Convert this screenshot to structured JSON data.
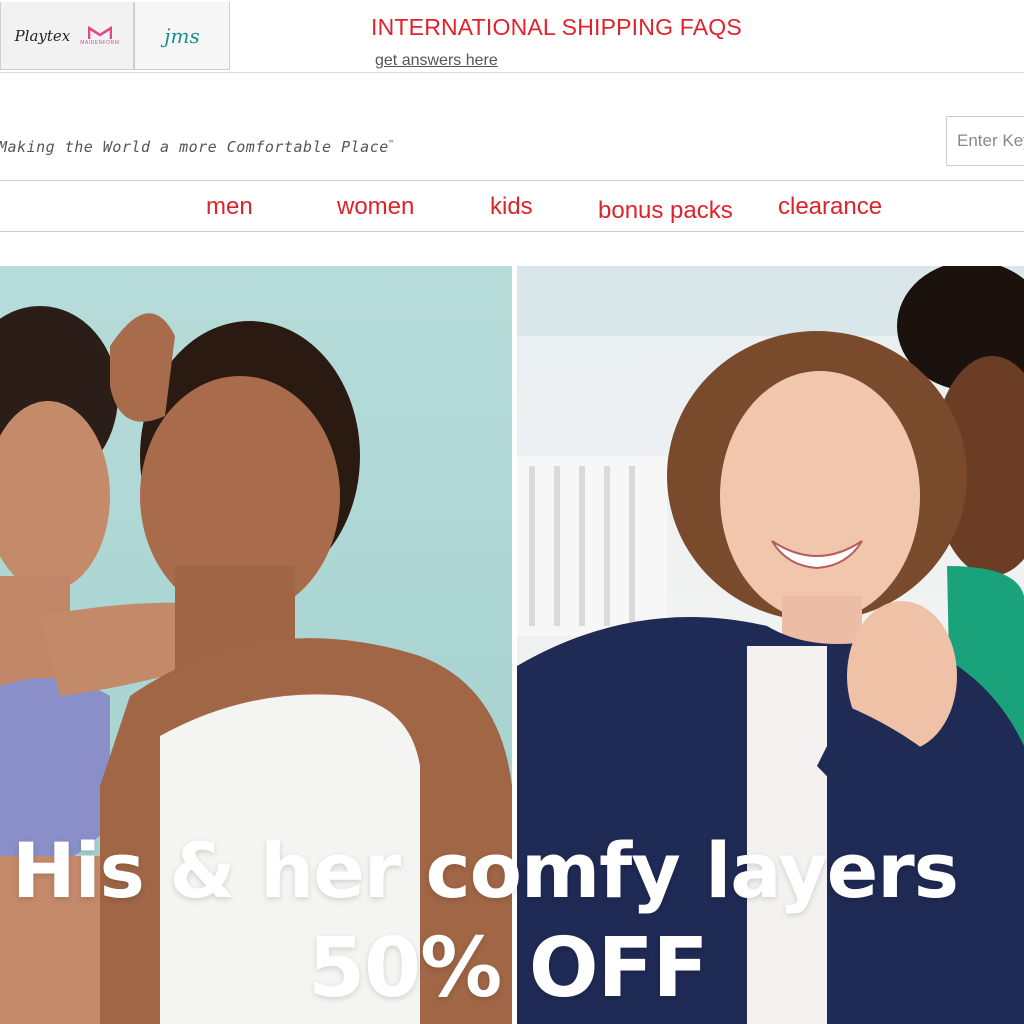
{
  "brand_tabs": {
    "playtex": "Playtex",
    "maidenform": "MAIDENFORM",
    "jms": "jms"
  },
  "promo": {
    "title": "INTERNATIONAL SHIPPING FAQS",
    "link": "get answers here"
  },
  "header": {
    "tagline": "Making the World a more Comfortable Place",
    "tagline_mark": "™",
    "search_placeholder": "Enter Keyword"
  },
  "nav": {
    "items": [
      {
        "label": "men"
      },
      {
        "label": "women"
      },
      {
        "label": "kids"
      },
      {
        "label": "bonus packs"
      },
      {
        "label": "clearance"
      }
    ]
  },
  "hero": {
    "headline": "His & her comfy layers",
    "offer": "50% OFF"
  },
  "colors": {
    "accent_red": "#e0222a",
    "hero_left_bg": "#a8d4d1",
    "hero_right_bg": "#eef0f1"
  }
}
